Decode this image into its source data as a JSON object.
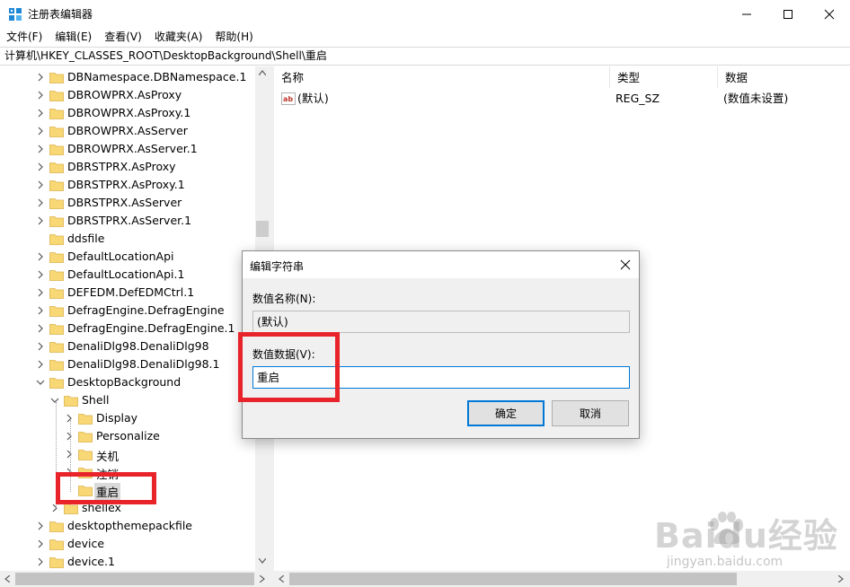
{
  "window": {
    "title": "注册表编辑器"
  },
  "menu": [
    "文件(F)",
    "编辑(E)",
    "查看(V)",
    "收藏夹(A)",
    "帮助(H)"
  ],
  "address": "计算机\\HKEY_CLASSES_ROOT\\DesktopBackground\\Shell\\重启",
  "tree": {
    "items": [
      {
        "label": "DBNamespace.DBNamespace.1",
        "expander": "collapsed"
      },
      {
        "label": "DBROWPRX.AsProxy",
        "expander": "collapsed"
      },
      {
        "label": "DBROWPRX.AsProxy.1",
        "expander": "collapsed"
      },
      {
        "label": "DBROWPRX.AsServer",
        "expander": "collapsed"
      },
      {
        "label": "DBROWPRX.AsServer.1",
        "expander": "collapsed"
      },
      {
        "label": "DBRSTPRX.AsProxy",
        "expander": "collapsed"
      },
      {
        "label": "DBRSTPRX.AsProxy.1",
        "expander": "collapsed"
      },
      {
        "label": "DBRSTPRX.AsServer",
        "expander": "collapsed"
      },
      {
        "label": "DBRSTPRX.AsServer.1",
        "expander": "collapsed"
      },
      {
        "label": "ddsfile",
        "expander": "none"
      },
      {
        "label": "DefaultLocationApi",
        "expander": "collapsed"
      },
      {
        "label": "DefaultLocationApi.1",
        "expander": "collapsed"
      },
      {
        "label": "DEFEDM.DefEDMCtrl.1",
        "expander": "collapsed"
      },
      {
        "label": "DefragEngine.DefragEngine",
        "expander": "collapsed"
      },
      {
        "label": "DefragEngine.DefragEngine.1",
        "expander": "collapsed"
      },
      {
        "label": "DenaliDlg98.DenaliDlg98",
        "expander": "collapsed"
      },
      {
        "label": "DenaliDlg98.DenaliDlg98.1",
        "expander": "collapsed"
      },
      {
        "label": "DesktopBackground",
        "expander": "expanded"
      },
      {
        "label": "Shell",
        "expander": "expanded"
      },
      {
        "label": "Display",
        "expander": "collapsed"
      },
      {
        "label": "Personalize",
        "expander": "collapsed"
      },
      {
        "label": "关机",
        "expander": "collapsed"
      },
      {
        "label": "注销",
        "expander": "collapsed"
      },
      {
        "label": "重启",
        "expander": "none",
        "selected": true
      },
      {
        "label": "shellex",
        "expander": "collapsed"
      },
      {
        "label": "desktopthemepackfile",
        "expander": "collapsed"
      },
      {
        "label": "device",
        "expander": "collapsed"
      },
      {
        "label": "device.1",
        "expander": "collapsed"
      }
    ]
  },
  "values": {
    "headers": {
      "name": "名称",
      "type": "类型",
      "data": "数据"
    },
    "rows": [
      {
        "icon": "string-value-icon",
        "name": "(默认)",
        "type": "REG_SZ",
        "data": "(数值未设置)"
      }
    ]
  },
  "dialog": {
    "title": "编辑字符串",
    "name_label": "数值名称(N):",
    "name_value": "(默认)",
    "data_label": "数值数据(V):",
    "data_value": "重启",
    "ok_label": "确定",
    "cancel_label": "取消"
  },
  "watermark": {
    "brand": "Baidu经验",
    "url": "jingyan.baidu.com"
  },
  "colors": {
    "highlight_red": "#e8242a",
    "accent_blue": "#0078d7",
    "folder_yellow": "#f8d775"
  }
}
